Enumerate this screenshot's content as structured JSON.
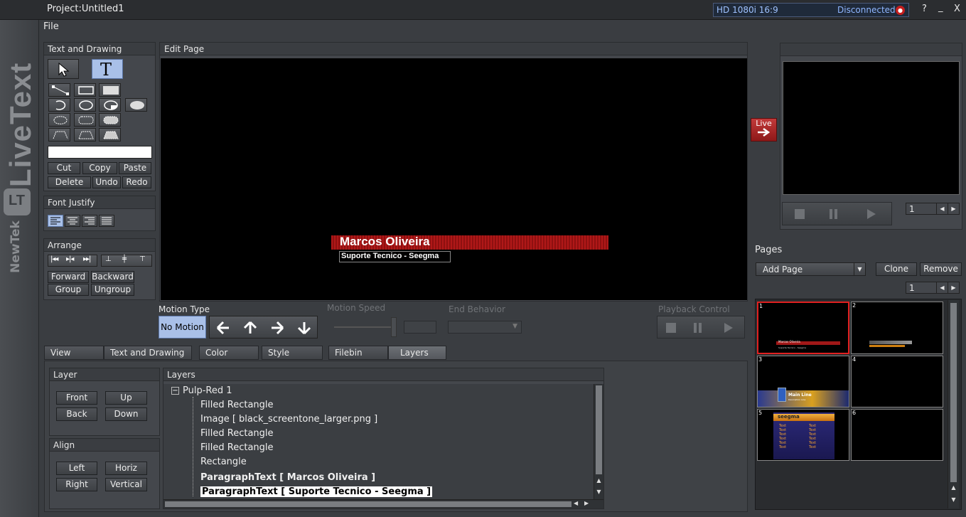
{
  "titlebar": {
    "project": "Project:Untitled1",
    "format": "HD 1080i 16:9",
    "status": "Disconnected",
    "help": "?",
    "minimize": "_",
    "close": "X"
  },
  "brand": {
    "logo": "LiveText",
    "maker": "NewTek",
    "tm": "™"
  },
  "menu": {
    "file": "File"
  },
  "text_drawing": {
    "title": "Text and Drawing",
    "cut": "Cut",
    "copy": "Copy",
    "paste": "Paste",
    "delete": "Delete",
    "undo": "Undo",
    "redo": "Redo",
    "text_value": ""
  },
  "font_justify": {
    "title": "Font Justify"
  },
  "arrange": {
    "title": "Arrange",
    "forward": "Forward",
    "backward": "Backward",
    "group": "Group",
    "ungroup": "Ungroup"
  },
  "edit_page": {
    "title": "Edit Page",
    "name": "Marcos Oliveira",
    "subtitle": "Suporte Tecnico - Seegma"
  },
  "motion": {
    "type_label": "Motion Type",
    "no_motion": "No Motion",
    "speed_label": "Motion Speed",
    "speed_value": "",
    "end_label": "End Behavior",
    "end_value": "",
    "playback_label": "Playback Control"
  },
  "tabs": [
    "View",
    "Text and Drawing",
    "Color",
    "Style",
    "Filebin",
    "Layers"
  ],
  "layer_panel": {
    "title": "Layer",
    "front": "Front",
    "up": "Up",
    "back": "Back",
    "down": "Down"
  },
  "align_panel": {
    "title": "Align",
    "left": "Left",
    "horiz": "Horiz",
    "right": "Right",
    "vertical": "Vertical"
  },
  "layers": {
    "title": "Layers",
    "root": "Pulp-Red 1",
    "items": [
      "Filled Rectangle",
      "Image [ black_screentone_larger.png ]",
      "Filled Rectangle",
      "Filled Rectangle",
      "Rectangle",
      "ParagraphText [ Marcos Oliveira ]",
      "ParagraphText [ Suporte Tecnico - Seegma ]"
    ]
  },
  "live": {
    "label": "Live",
    "preview_page": "1"
  },
  "pages": {
    "title": "Pages",
    "add": "Add Page",
    "clone": "Clone",
    "remove": "Remove",
    "page_num": "1",
    "thumbs": [
      {
        "n": "1",
        "name": "Marcos Oliveira",
        "sub": "Suporte Tecnico - Seegma"
      },
      {
        "n": "2"
      },
      {
        "n": "3",
        "name": "Main Line",
        "sub": "Description Line"
      },
      {
        "n": "4"
      },
      {
        "n": "5",
        "name": "seegma",
        "rows": "Text"
      },
      {
        "n": "6"
      }
    ]
  },
  "colors": {
    "accent": "#c41e1e",
    "selected_blue": "#a9c0e8",
    "status_red": "#c41e1e"
  }
}
